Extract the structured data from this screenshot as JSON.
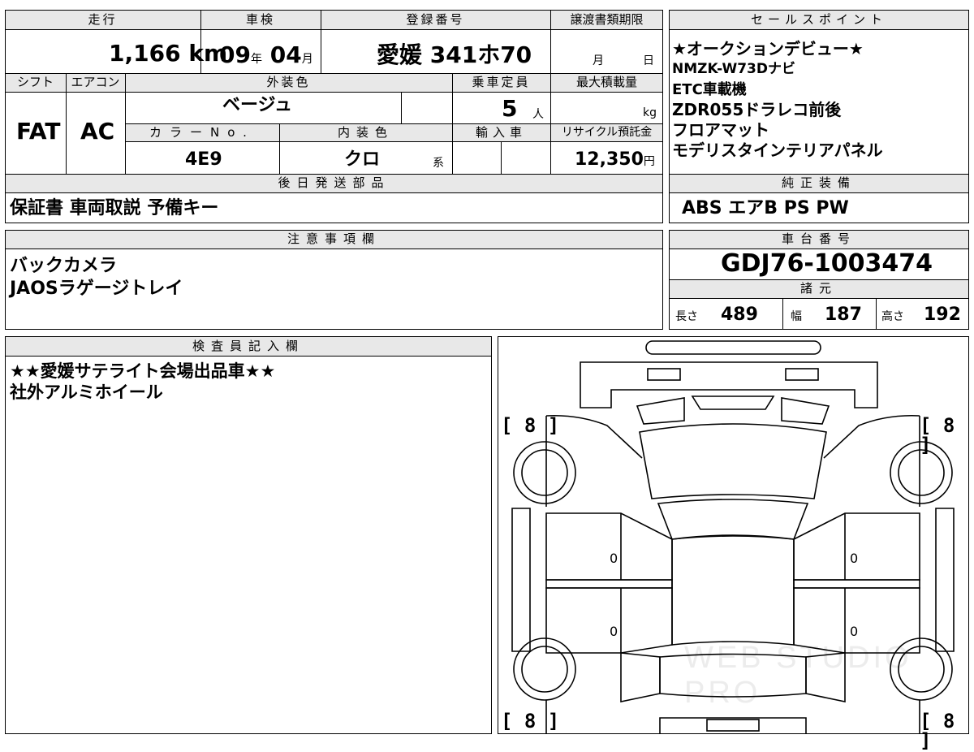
{
  "main": {
    "mileage_label": "走行",
    "mileage_value": "1,166",
    "mileage_unit": "km",
    "inspection_label": "車検",
    "inspection_year": "09",
    "year_unit": "年",
    "inspection_month": "04",
    "month_unit": "月",
    "registration_label": "登録番号",
    "registration_value": "愛媛 341ホ70",
    "transfer_label": "譲渡書類期限",
    "transfer_month_unit": "月",
    "transfer_day_unit": "日",
    "shift_label": "シフト",
    "shift_value": "FAT",
    "aircon_label": "エアコン",
    "aircon_value": "AC",
    "exterior_label": "外装色",
    "exterior_value": "ベージュ",
    "capacity_label": "乗車定員",
    "capacity_value": "5",
    "capacity_unit": "人",
    "max_load_label": "最大積載量",
    "max_load_unit": "kg",
    "color_no_label": "カラーNo.",
    "color_no_value": "4E9",
    "interior_label": "内装色",
    "interior_value": "クロ",
    "interior_unit": "系",
    "import_label": "輸入車",
    "recycle_label": "リサイクル預託金",
    "recycle_value": "12,350",
    "recycle_unit": "円",
    "later_items_label": "後日発送部品",
    "later_items_value": "保証書 車両取説 予備キー"
  },
  "sales": {
    "label": "セールスポイント",
    "items": [
      "★オークションデビュー★",
      "NMZK-W73Dナビ",
      "ETC車載機",
      "ZDR055ドラレコ前後",
      "フロアマット",
      "モデリスタインテリアパネル"
    ]
  },
  "standard_equipment": {
    "label": "純正装備",
    "value": "ABS エアB PS PW"
  },
  "notes": {
    "label": "注意事項欄",
    "items": [
      "バックカメラ",
      "JAOSラゲージトレイ"
    ]
  },
  "chassis": {
    "label": "車台番号",
    "value": "GDJ76-1003474"
  },
  "specs": {
    "label": "諸元",
    "length_label": "長さ",
    "length_value": "489",
    "width_label": "幅",
    "width_value": "187",
    "height_label": "高さ",
    "height_value": "192"
  },
  "inspector": {
    "label": "検査員記入欄",
    "items": [
      "★★愛媛サテライト会場出品車★★",
      "社外アルミホイール"
    ]
  },
  "diagram": {
    "tire_fl": "[ 8 ]",
    "tire_fr": "[ 8 ]",
    "tire_rl": "[ 8 ]",
    "tire_rr": "[ 8 ]",
    "door_fl": "0",
    "door_fr": "0",
    "door_rl": "0",
    "door_rr": "0",
    "watermark": "WEB STUDIO PRO"
  }
}
